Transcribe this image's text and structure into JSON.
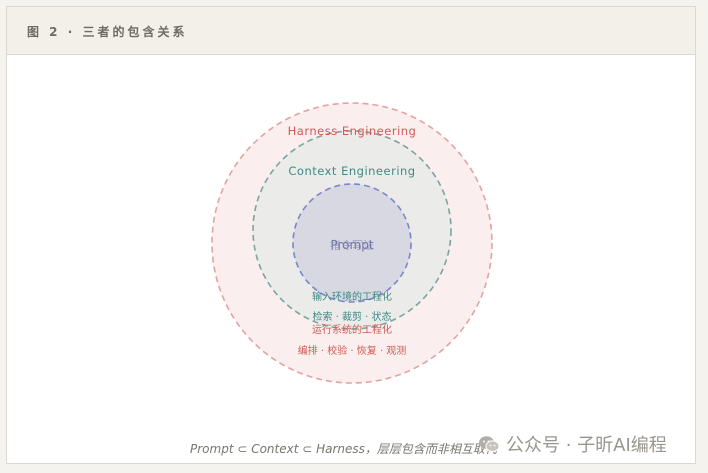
{
  "header": {
    "title": "图 2 · 三者的包含关系"
  },
  "diagram": {
    "outer": {
      "label": "Harness Engineering",
      "description": "运行系统的工程化",
      "items": "编排 · 校验 · 恢复 · 观测",
      "color": "#d9534f"
    },
    "middle": {
      "label": "Context Engineering",
      "description": "输入环境的工程化",
      "items": "检索 · 裁剪 · 状态",
      "color": "#3f8a85"
    },
    "inner": {
      "label": "Prompt",
      "overlap_text": "指令写法",
      "color": "#6670b3"
    }
  },
  "caption": "Prompt ⊂ Context ⊂ Harness，层层包含而非相互取代",
  "watermark": {
    "text": "公众号 · 子昕AI编程",
    "icon": "wechat-icon"
  }
}
